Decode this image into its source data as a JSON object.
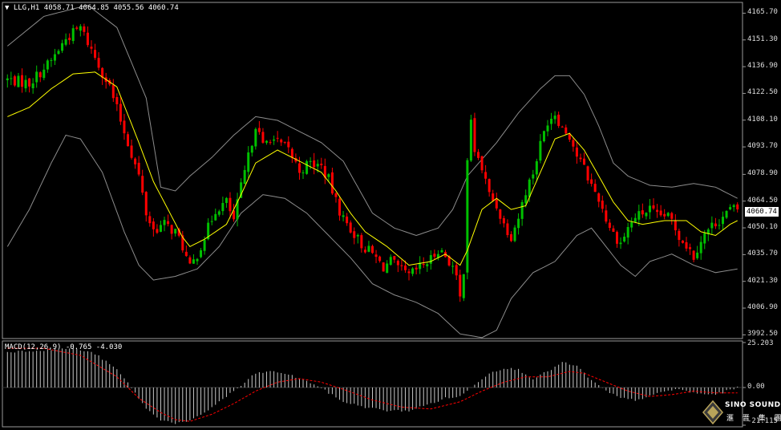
{
  "header": {
    "symbol": "LLG,H1",
    "ohlc": "4058.71 4064.85 4055.56 4060.74",
    "macd_label": "MACD(12,26,9) -0.765 -4.030"
  },
  "colors": {
    "background": "#000000",
    "bull": "#00c000",
    "bear": "#ff0000",
    "bands": "#8c8c8c",
    "ma": "#ffff00",
    "macd_hist": "#c8c8c8",
    "macd_signal": "#ff0000",
    "frame": "#9a9a9a"
  },
  "chart_data": [
    {
      "type": "candlestick",
      "symbol": "LLG",
      "timeframe": "H1",
      "last_price": "4060.74",
      "y_ticks": [
        "4165.70",
        "4151.30",
        "4136.90",
        "4122.50",
        "4108.10",
        "4093.70",
        "4078.90",
        "4064.50",
        "4050.10",
        "4035.70",
        "4021.30",
        "4006.90",
        "3992.50"
      ],
      "ylim": [
        3990.5,
        4171.5
      ],
      "indicators": [
        "Bollinger Bands",
        "Moving Average"
      ],
      "close_path": [
        [
          0,
          4130
        ],
        [
          6,
          4128
        ],
        [
          12,
          4140
        ],
        [
          16,
          4152
        ],
        [
          20,
          4158
        ],
        [
          24,
          4142
        ],
        [
          28,
          4126
        ],
        [
          32,
          4102
        ],
        [
          36,
          4078
        ],
        [
          38,
          4058
        ],
        [
          40,
          4049
        ],
        [
          43,
          4052
        ],
        [
          46,
          4048
        ],
        [
          48,
          4040
        ],
        [
          50,
          4028
        ],
        [
          52,
          4036
        ],
        [
          55,
          4050
        ],
        [
          57,
          4060
        ],
        [
          60,
          4064
        ],
        [
          62,
          4054
        ],
        [
          64,
          4072
        ],
        [
          66,
          4088
        ],
        [
          68,
          4106
        ],
        [
          70,
          4094
        ],
        [
          72,
          4099
        ],
        [
          74,
          4096
        ],
        [
          77,
          4092
        ],
        [
          80,
          4081
        ],
        [
          83,
          4085
        ],
        [
          86,
          4083
        ],
        [
          88,
          4076
        ],
        [
          90,
          4064
        ],
        [
          92,
          4055
        ],
        [
          95,
          4047
        ],
        [
          97,
          4041
        ],
        [
          100,
          4036
        ],
        [
          103,
          4029
        ],
        [
          105,
          4032
        ],
        [
          107,
          4028
        ],
        [
          110,
          4024
        ],
        [
          113,
          4029
        ],
        [
          116,
          4033
        ],
        [
          118,
          4039
        ],
        [
          120,
          4035
        ],
        [
          122,
          4029
        ],
        [
          123,
          4022
        ],
        [
          124,
          4012
        ],
        [
          125,
          4028
        ],
        [
          126,
          4088
        ],
        [
          127,
          4106
        ],
        [
          128,
          4092
        ],
        [
          130,
          4082
        ],
        [
          132,
          4068
        ],
        [
          134,
          4062
        ],
        [
          136,
          4052
        ],
        [
          138,
          4046
        ],
        [
          140,
          4056
        ],
        [
          142,
          4070
        ],
        [
          144,
          4080
        ],
        [
          146,
          4095
        ],
        [
          148,
          4108
        ],
        [
          150,
          4112
        ],
        [
          152,
          4104
        ],
        [
          154,
          4100
        ],
        [
          156,
          4089
        ],
        [
          158,
          4082
        ],
        [
          160,
          4073
        ],
        [
          162,
          4066
        ],
        [
          164,
          4055
        ],
        [
          166,
          4047
        ],
        [
          168,
          4042
        ],
        [
          170,
          4050
        ],
        [
          172,
          4056
        ],
        [
          174,
          4058
        ],
        [
          176,
          4060
        ],
        [
          178,
          4056
        ],
        [
          180,
          4057
        ],
        [
          182,
          4054
        ],
        [
          184,
          4046
        ],
        [
          186,
          4041
        ],
        [
          188,
          4035
        ],
        [
          190,
          4044
        ],
        [
          192,
          4049
        ],
        [
          194,
          4053
        ],
        [
          196,
          4056
        ],
        [
          198,
          4060
        ]
      ],
      "bb_upper": [
        [
          0,
          4148
        ],
        [
          10,
          4164
        ],
        [
          22,
          4170
        ],
        [
          30,
          4158
        ],
        [
          38,
          4120
        ],
        [
          42,
          4072
        ],
        [
          46,
          4070
        ],
        [
          50,
          4078
        ],
        [
          56,
          4088
        ],
        [
          62,
          4100
        ],
        [
          68,
          4110
        ],
        [
          74,
          4108
        ],
        [
          80,
          4102
        ],
        [
          86,
          4096
        ],
        [
          92,
          4086
        ],
        [
          96,
          4072
        ],
        [
          100,
          4058
        ],
        [
          106,
          4050
        ],
        [
          112,
          4046
        ],
        [
          118,
          4050
        ],
        [
          122,
          4060
        ],
        [
          126,
          4078
        ],
        [
          134,
          4096
        ],
        [
          140,
          4112
        ],
        [
          146,
          4125
        ],
        [
          150,
          4132
        ],
        [
          154,
          4132
        ],
        [
          158,
          4122
        ],
        [
          162,
          4105
        ],
        [
          166,
          4085
        ],
        [
          170,
          4078
        ],
        [
          176,
          4073
        ],
        [
          182,
          4072
        ],
        [
          188,
          4074
        ],
        [
          194,
          4072
        ],
        [
          200,
          4066
        ]
      ],
      "bb_lower": [
        [
          0,
          4040
        ],
        [
          6,
          4060
        ],
        [
          12,
          4085
        ],
        [
          16,
          4100
        ],
        [
          20,
          4098
        ],
        [
          26,
          4080
        ],
        [
          32,
          4048
        ],
        [
          36,
          4030
        ],
        [
          40,
          4022
        ],
        [
          46,
          4024
        ],
        [
          52,
          4028
        ],
        [
          58,
          4040
        ],
        [
          64,
          4058
        ],
        [
          70,
          4068
        ],
        [
          76,
          4066
        ],
        [
          82,
          4058
        ],
        [
          88,
          4046
        ],
        [
          94,
          4034
        ],
        [
          100,
          4020
        ],
        [
          106,
          4014
        ],
        [
          112,
          4010
        ],
        [
          118,
          4004
        ],
        [
          124,
          3993
        ],
        [
          130,
          3991
        ],
        [
          134,
          3995
        ],
        [
          138,
          4012
        ],
        [
          144,
          4026
        ],
        [
          150,
          4032
        ],
        [
          156,
          4046
        ],
        [
          160,
          4050
        ],
        [
          164,
          4040
        ],
        [
          168,
          4030
        ],
        [
          172,
          4024
        ],
        [
          176,
          4032
        ],
        [
          182,
          4036
        ],
        [
          188,
          4030
        ],
        [
          194,
          4026
        ],
        [
          200,
          4028
        ]
      ],
      "ma": [
        [
          0,
          4110
        ],
        [
          6,
          4115
        ],
        [
          12,
          4125
        ],
        [
          18,
          4133
        ],
        [
          24,
          4134
        ],
        [
          30,
          4126
        ],
        [
          36,
          4096
        ],
        [
          40,
          4075
        ],
        [
          44,
          4060
        ],
        [
          48,
          4045
        ],
        [
          50,
          4040
        ],
        [
          54,
          4044
        ],
        [
          60,
          4052
        ],
        [
          64,
          4068
        ],
        [
          68,
          4085
        ],
        [
          74,
          4092
        ],
        [
          80,
          4086
        ],
        [
          86,
          4080
        ],
        [
          90,
          4070
        ],
        [
          94,
          4058
        ],
        [
          98,
          4048
        ],
        [
          104,
          4040
        ],
        [
          110,
          4030
        ],
        [
          116,
          4032
        ],
        [
          120,
          4036
        ],
        [
          124,
          4030
        ],
        [
          126,
          4038
        ],
        [
          130,
          4060
        ],
        [
          134,
          4066
        ],
        [
          138,
          4060
        ],
        [
          142,
          4062
        ],
        [
          146,
          4080
        ],
        [
          150,
          4098
        ],
        [
          154,
          4101
        ],
        [
          158,
          4092
        ],
        [
          162,
          4078
        ],
        [
          166,
          4064
        ],
        [
          170,
          4054
        ],
        [
          174,
          4052
        ],
        [
          180,
          4054
        ],
        [
          186,
          4054
        ],
        [
          190,
          4048
        ],
        [
          194,
          4046
        ],
        [
          198,
          4052
        ],
        [
          200,
          4054
        ]
      ]
    },
    {
      "type": "bar",
      "name": "MACD(12,26,9)",
      "value": -0.765,
      "signal": -4.03,
      "y_ticks": [
        "25.203",
        "0.00",
        "-21.115"
      ],
      "ylim": [
        -21.115,
        25.203
      ],
      "hist_path": [
        [
          0,
          20
        ],
        [
          10,
          21
        ],
        [
          18,
          22
        ],
        [
          24,
          19
        ],
        [
          30,
          10
        ],
        [
          34,
          0
        ],
        [
          38,
          -12
        ],
        [
          42,
          -18
        ],
        [
          46,
          -20
        ],
        [
          50,
          -19
        ],
        [
          54,
          -14
        ],
        [
          58,
          -8
        ],
        [
          62,
          -2
        ],
        [
          64,
          1
        ],
        [
          68,
          8
        ],
        [
          72,
          9
        ],
        [
          76,
          8
        ],
        [
          80,
          5
        ],
        [
          84,
          2
        ],
        [
          88,
          -3
        ],
        [
          92,
          -8
        ],
        [
          98,
          -11
        ],
        [
          104,
          -13
        ],
        [
          110,
          -13
        ],
        [
          116,
          -9
        ],
        [
          120,
          -6
        ],
        [
          124,
          -5
        ],
        [
          126,
          -2
        ],
        [
          128,
          2
        ],
        [
          132,
          8
        ],
        [
          136,
          11
        ],
        [
          140,
          10
        ],
        [
          144,
          5
        ],
        [
          148,
          9
        ],
        [
          152,
          14
        ],
        [
          156,
          12
        ],
        [
          160,
          4
        ],
        [
          164,
          -2
        ],
        [
          168,
          -6
        ],
        [
          172,
          -7
        ],
        [
          176,
          -5
        ],
        [
          180,
          -2
        ],
        [
          184,
          -1
        ],
        [
          188,
          -3
        ],
        [
          192,
          -4
        ],
        [
          196,
          -3
        ],
        [
          198,
          -1
        ],
        [
          200,
          0
        ]
      ],
      "signal_path": [
        [
          0,
          22
        ],
        [
          10,
          22
        ],
        [
          20,
          18
        ],
        [
          30,
          6
        ],
        [
          36,
          -6
        ],
        [
          42,
          -14
        ],
        [
          46,
          -18
        ],
        [
          50,
          -19
        ],
        [
          56,
          -15
        ],
        [
          62,
          -9
        ],
        [
          68,
          -2
        ],
        [
          74,
          3
        ],
        [
          80,
          5
        ],
        [
          86,
          3
        ],
        [
          92,
          -1
        ],
        [
          100,
          -7
        ],
        [
          108,
          -11
        ],
        [
          116,
          -12
        ],
        [
          124,
          -8
        ],
        [
          130,
          -2
        ],
        [
          136,
          3
        ],
        [
          142,
          6
        ],
        [
          148,
          6
        ],
        [
          154,
          9
        ],
        [
          158,
          8
        ],
        [
          164,
          3
        ],
        [
          170,
          -2
        ],
        [
          176,
          -5
        ],
        [
          182,
          -4
        ],
        [
          188,
          -2
        ],
        [
          194,
          -3
        ],
        [
          200,
          -3
        ]
      ]
    }
  ],
  "logo": {
    "brand": "SINO SOUND",
    "chinese": "滙 晋 集 團"
  }
}
